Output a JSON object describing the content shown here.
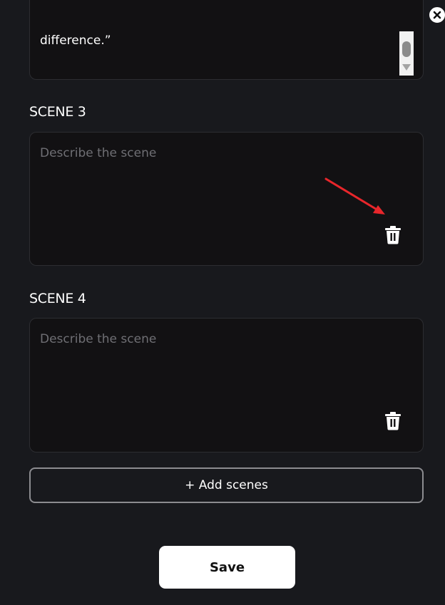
{
  "previous_scene": {
    "text_tail": "difference.”"
  },
  "scenes": [
    {
      "label": "SCENE 3",
      "placeholder": "Describe the scene",
      "value": ""
    },
    {
      "label": "SCENE 4",
      "placeholder": "Describe the scene",
      "value": ""
    }
  ],
  "actions": {
    "add_scenes_label": "+ Add scenes",
    "save_label": "Save"
  },
  "icons": {
    "close": "close-icon",
    "delete": "trash-icon",
    "annotation": "red-arrow"
  },
  "colors": {
    "background": "#18191d",
    "textbox_bg": "#121113",
    "annotation": "#e8262b"
  }
}
